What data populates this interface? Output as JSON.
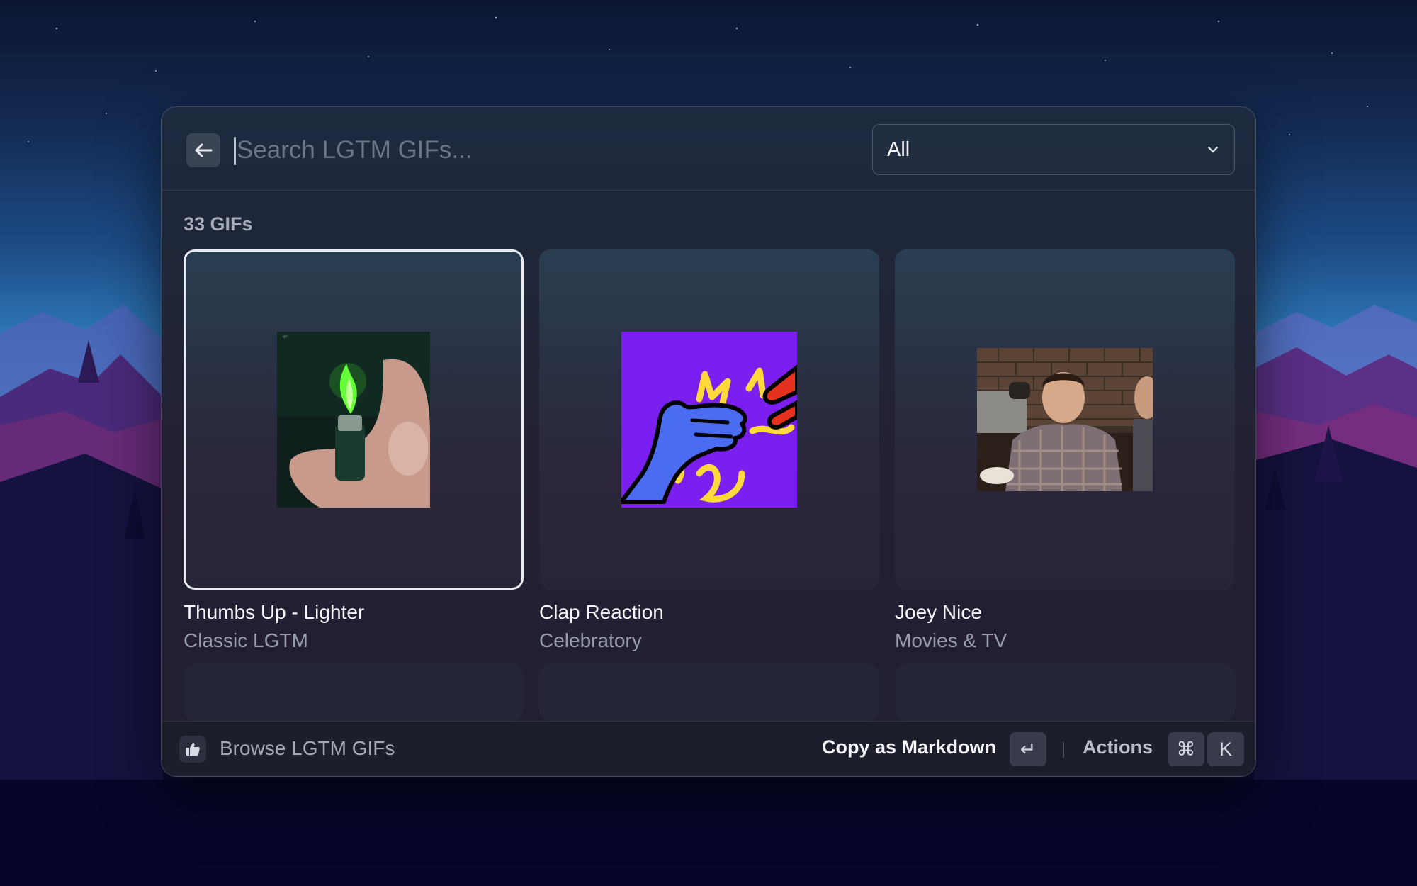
{
  "search": {
    "placeholder": "Search LGTM GIFs...",
    "value": ""
  },
  "filter": {
    "selected": "All"
  },
  "results": {
    "count_label": "33 GIFs",
    "items": [
      {
        "title": "Thumbs Up - Lighter",
        "category": "Classic LGTM",
        "selected": true
      },
      {
        "title": "Clap Reaction",
        "category": "Celebratory",
        "selected": false
      },
      {
        "title": "Joey Nice",
        "category": "Movies & TV",
        "selected": false
      }
    ]
  },
  "footer": {
    "title": "Browse LGTM GIFs",
    "primary_action": "Copy as Markdown",
    "primary_key": "↵",
    "actions_label": "Actions",
    "actions_keys": [
      "⌘",
      "K"
    ]
  },
  "colors": {
    "selection_border": "#e9ecf2",
    "clap_background": "#7a1ff0"
  }
}
